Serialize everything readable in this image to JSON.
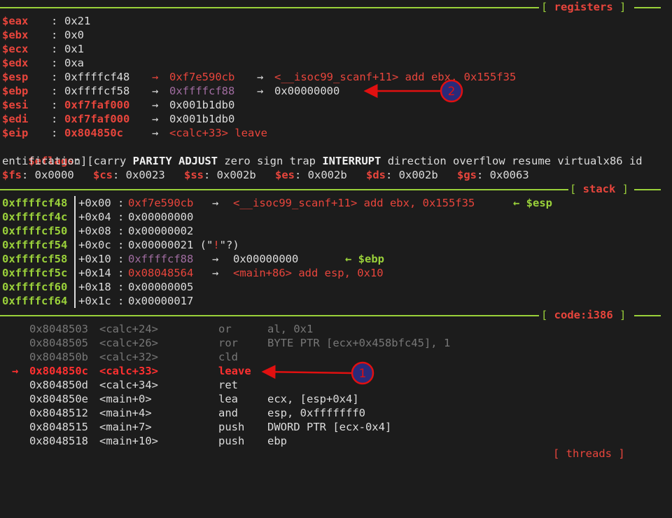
{
  "headers": {
    "registers": "registers",
    "stack": "stack",
    "code": "code:i386",
    "threads_partial": "[ threads ]"
  },
  "registers": {
    "eax": {
      "name": "$eax",
      "value": "0x21"
    },
    "ebx": {
      "name": "$ebx",
      "value": "0x0"
    },
    "ecx": {
      "name": "$ecx",
      "value": "0x1"
    },
    "edx": {
      "name": "$edx",
      "value": "0xa"
    },
    "esp": {
      "name": "$esp",
      "value": "0xffffcf48",
      "ptr1": "0xf7e590cb",
      "ptr2": "<__isoc99_scanf+11> add ebx, 0x155f35"
    },
    "ebp": {
      "name": "$ebp",
      "value": "0xffffcf58",
      "ptr1": "0xffffcf88",
      "ptr2": "0x00000000"
    },
    "esi": {
      "name": "$esi",
      "value": "0xf7faf000",
      "ptr1": "0x001b1db0"
    },
    "edi": {
      "name": "$edi",
      "value": "0xf7faf000",
      "ptr1": "0x001b1db0"
    },
    "eip": {
      "name": "$eip",
      "value": "0x804850c",
      "ptr1": "<calc+33> leave"
    },
    "eflags": {
      "name": "$eflags",
      "open": "[carry ",
      "parity": "PARITY",
      "adjust": "ADJUST",
      "mid": "zero sign trap",
      "interrupt": "INTERRUPT",
      "rest": "direction overflow resume virtualx86 id",
      "wrap": "entification]"
    },
    "segments": [
      {
        "name": "$fs",
        "value": "0x0000"
      },
      {
        "name": "$cs",
        "value": "0x0023"
      },
      {
        "name": "$ss",
        "value": "0x002b"
      },
      {
        "name": "$es",
        "value": "0x002b"
      },
      {
        "name": "$ds",
        "value": "0x002b"
      },
      {
        "name": "$gs",
        "value": "0x0063"
      }
    ]
  },
  "stack": [
    {
      "addr": "0xffffcf48",
      "off": "+0x00",
      "val": "0xf7e590cb",
      "p1": "<__isoc99_scanf+11> add ebx, 0x155f35",
      "mark": "← $esp"
    },
    {
      "addr": "0xffffcf4c",
      "off": "+0x04",
      "val": "0x00000000"
    },
    {
      "addr": "0xffffcf50",
      "off": "+0x08",
      "val": "0x00000002"
    },
    {
      "addr": "0xffffcf54",
      "off": "+0x0c",
      "val": "0x00000021",
      "str_open": " (\"",
      "str_char": "!",
      "str_close": "\"?)"
    },
    {
      "addr": "0xffffcf58",
      "off": "+0x10",
      "val": "0xffffcf88",
      "p1": "0x00000000",
      "mark": "← $ebp"
    },
    {
      "addr": "0xffffcf5c",
      "off": "+0x14",
      "val": "0x08048564",
      "p1": "<main+86> add esp, 0x10"
    },
    {
      "addr": "0xffffcf60",
      "off": "+0x18",
      "val": "0x00000005"
    },
    {
      "addr": "0xffffcf64",
      "off": "+0x1c",
      "val": "0x00000017"
    }
  ],
  "code": [
    {
      "addr": "0x8048503",
      "sym": "<calc+24>",
      "op": "or",
      "args": "al, 0x1"
    },
    {
      "addr": "0x8048505",
      "sym": "<calc+26>",
      "op": "ror",
      "args": "BYTE PTR [ecx+0x458bfc45], 1"
    },
    {
      "addr": "0x804850b",
      "sym": "<calc+32>",
      "op": "cld",
      "args": ""
    },
    {
      "addr": "0x804850c",
      "sym": "<calc+33>",
      "op": "leave",
      "args": "",
      "arrow": "→"
    },
    {
      "addr": "0x804850d",
      "sym": "<calc+34>",
      "op": "ret",
      "args": ""
    },
    {
      "addr": "0x804850e",
      "sym": "<main+0>",
      "op": "lea",
      "args": "ecx, [esp+0x4]"
    },
    {
      "addr": "0x8048512",
      "sym": "<main+4>",
      "op": "and",
      "args": "esp, 0xfffffff0"
    },
    {
      "addr": "0x8048515",
      "sym": "<main+7>",
      "op": "push",
      "args": "DWORD PTR [ecx-0x4]"
    },
    {
      "addr": "0x8048518",
      "sym": "<main+10>",
      "op": "push",
      "args": "ebp"
    }
  ],
  "annotations": {
    "one": "1",
    "two": "2"
  },
  "arrow": "→",
  "colon": ":"
}
